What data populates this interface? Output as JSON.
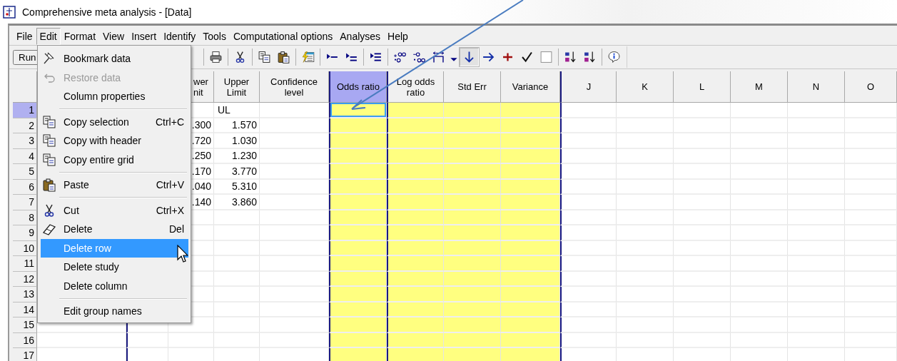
{
  "window": {
    "title": "Comprehensive meta analysis - [Data]"
  },
  "menu_bar": [
    {
      "label": "File",
      "selected": false
    },
    {
      "label": "Edit",
      "selected": true
    },
    {
      "label": "Format",
      "selected": false
    },
    {
      "label": "View",
      "selected": false
    },
    {
      "label": "Insert",
      "selected": false
    },
    {
      "label": "Identify",
      "selected": false
    },
    {
      "label": "Tools",
      "selected": false
    },
    {
      "label": "Computational options",
      "selected": false
    },
    {
      "label": "Analyses",
      "selected": false
    },
    {
      "label": "Help",
      "selected": false
    }
  ],
  "toolbar": {
    "run_label": "Run",
    "buttons": [
      {
        "pressed": false
      },
      {
        "pressed": false
      },
      {
        "pressed": false
      },
      {
        "pressed": false
      },
      {
        "pressed": false
      },
      {
        "pressed": false
      },
      {
        "pressed": false
      },
      {
        "pressed": false
      },
      {
        "pressed": false
      },
      {
        "pressed": false
      },
      {
        "pressed": false
      },
      {
        "pressed": false
      },
      {
        "pressed": true
      },
      {
        "pressed": false
      },
      {
        "pressed": false
      },
      {
        "pressed": false
      },
      {
        "pressed": false
      },
      {
        "pressed": false
      },
      {
        "pressed": false
      },
      {
        "pressed": false
      }
    ]
  },
  "grid": {
    "columns": [
      {
        "computed": false,
        "group_start": false
      },
      {
        "computed": false,
        "group_start": true
      },
      {
        "label": "wer\nnit",
        "selected": false,
        "computed": false,
        "group_start": false
      },
      {
        "label": "Upper\nLimit",
        "selected": false,
        "computed": false,
        "group_start": false
      },
      {
        "label": "Confidence\nlevel",
        "selected": false,
        "computed": false,
        "group_start": false
      },
      {
        "label": "Odds ratio",
        "selected": true,
        "computed": true,
        "group_start": true
      },
      {
        "label": "Log odds\nratio",
        "selected": false,
        "computed": true,
        "group_start": true
      },
      {
        "label": "Std Err",
        "selected": false,
        "computed": true,
        "group_start": false
      },
      {
        "label": "Variance",
        "selected": false,
        "computed": true,
        "group_start": false
      },
      {
        "label": "J",
        "selected": false,
        "computed": false,
        "group_start": true
      },
      {
        "label": "K",
        "selected": false,
        "computed": false,
        "group_start": false
      },
      {
        "label": "L",
        "selected": false,
        "computed": false,
        "group_start": false
      },
      {
        "label": "M",
        "selected": false,
        "computed": false,
        "group_start": false
      },
      {
        "label": "N",
        "selected": false,
        "computed": false,
        "group_start": false
      },
      {
        "label": "O",
        "selected": false,
        "computed": false,
        "group_start": false
      }
    ],
    "rows": [
      {
        "number": "1",
        "selected": true,
        "kind": "labels",
        "upper_limit": "UL"
      },
      {
        "number": "2",
        "selected": false,
        "kind": "data",
        "lower_limit": ".300",
        "upper_limit": "1.570"
      },
      {
        "number": "3",
        "selected": false,
        "kind": "data",
        "lower_limit": ".720",
        "upper_limit": "1.030"
      },
      {
        "number": "4",
        "selected": false,
        "kind": "data",
        "lower_limit": ".250",
        "upper_limit": "1.230"
      },
      {
        "number": "5",
        "selected": false,
        "kind": "data",
        "lower_limit": ".170",
        "upper_limit": "3.770"
      },
      {
        "number": "6",
        "selected": false,
        "kind": "data",
        "lower_limit": ".040",
        "upper_limit": "5.310"
      },
      {
        "number": "7",
        "selected": false,
        "kind": "data",
        "lower_limit": ".140",
        "upper_limit": "3.860"
      },
      {
        "number": "8",
        "selected": false,
        "kind": "data"
      },
      {
        "number": "9",
        "selected": false,
        "kind": "data"
      },
      {
        "number": "10",
        "selected": false,
        "kind": "data"
      },
      {
        "number": "11",
        "selected": false,
        "kind": "data"
      },
      {
        "number": "12",
        "selected": false,
        "kind": "data"
      },
      {
        "number": "13",
        "selected": false,
        "kind": "data"
      },
      {
        "number": "14",
        "selected": false,
        "kind": "data"
      },
      {
        "number": "15",
        "selected": false,
        "kind": "data"
      },
      {
        "number": "16",
        "selected": false,
        "kind": "data"
      },
      {
        "number": "17",
        "selected": false,
        "kind": "data"
      }
    ]
  },
  "edit_menu": {
    "items": [
      {
        "kind": "item",
        "label": "Bookmark data",
        "disabled": false,
        "selected": false
      },
      {
        "kind": "item",
        "label": "Restore data",
        "disabled": true,
        "selected": false
      },
      {
        "kind": "item",
        "label": "Column properties",
        "disabled": false,
        "selected": false
      },
      {
        "kind": "separator"
      },
      {
        "kind": "item",
        "label": "Copy selection",
        "shortcut": "Ctrl+C",
        "disabled": false,
        "selected": false
      },
      {
        "kind": "item",
        "label": "Copy with header",
        "disabled": false,
        "selected": false
      },
      {
        "kind": "item",
        "label": "Copy entire grid",
        "disabled": false,
        "selected": false
      },
      {
        "kind": "separator"
      },
      {
        "kind": "item",
        "label": "Paste",
        "shortcut": "Ctrl+V",
        "disabled": false,
        "selected": false
      },
      {
        "kind": "separator"
      },
      {
        "kind": "item",
        "label": "Cut",
        "shortcut": "Ctrl+X",
        "disabled": false,
        "selected": false
      },
      {
        "kind": "item",
        "label": "Delete",
        "shortcut": "Del",
        "disabled": false,
        "selected": false
      },
      {
        "kind": "item",
        "label": "Delete row",
        "disabled": false,
        "selected": true
      },
      {
        "kind": "item",
        "label": "Delete study",
        "disabled": false,
        "selected": false
      },
      {
        "kind": "item",
        "label": "Delete column",
        "disabled": false,
        "selected": false
      },
      {
        "kind": "separator"
      },
      {
        "kind": "item",
        "label": "Edit group names",
        "disabled": false,
        "selected": false
      }
    ]
  }
}
